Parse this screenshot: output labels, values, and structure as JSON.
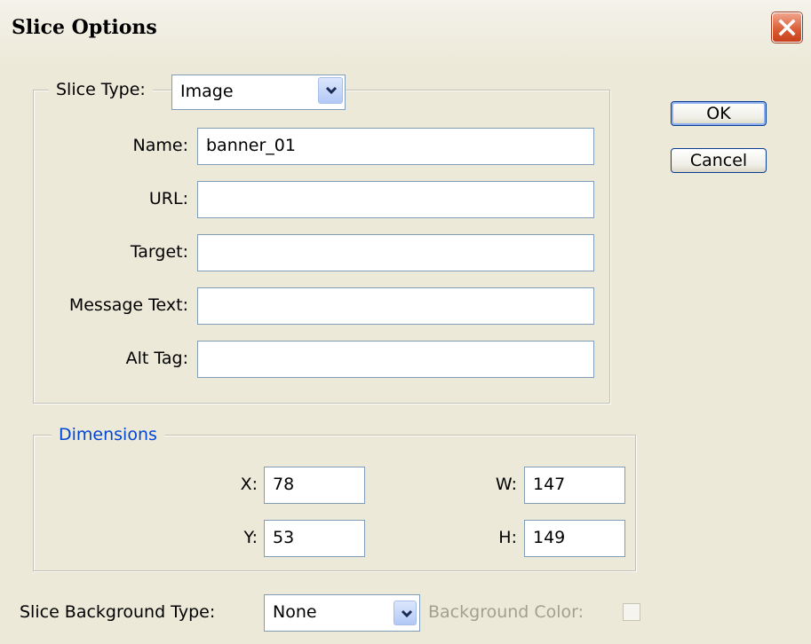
{
  "window": {
    "title": "Slice Options",
    "close_icon": "close-icon"
  },
  "buttons": {
    "ok": "OK",
    "cancel": "Cancel"
  },
  "slice_type": {
    "label": "Slice Type:",
    "value": "Image"
  },
  "fields": [
    {
      "label": "Name:",
      "value": "banner_01"
    },
    {
      "label": "URL:",
      "value": ""
    },
    {
      "label": "Target:",
      "value": ""
    },
    {
      "label": "Message Text:",
      "value": ""
    },
    {
      "label": "Alt Tag:",
      "value": ""
    }
  ],
  "dimensions": {
    "legend": "Dimensions",
    "legend_color": "#0046D5",
    "x": {
      "label": "X:",
      "value": "78"
    },
    "y": {
      "label": "Y:",
      "value": "53"
    },
    "w": {
      "label": "W:",
      "value": "147"
    },
    "h": {
      "label": "H:",
      "value": "149"
    }
  },
  "background": {
    "type_label": "Slice Background Type:",
    "type_value": "None",
    "color_label": "Background Color:"
  },
  "colors": {
    "dialog_bg": "#ECE9D8",
    "field_border": "#7f9db9",
    "close_red": "#D85A33"
  }
}
